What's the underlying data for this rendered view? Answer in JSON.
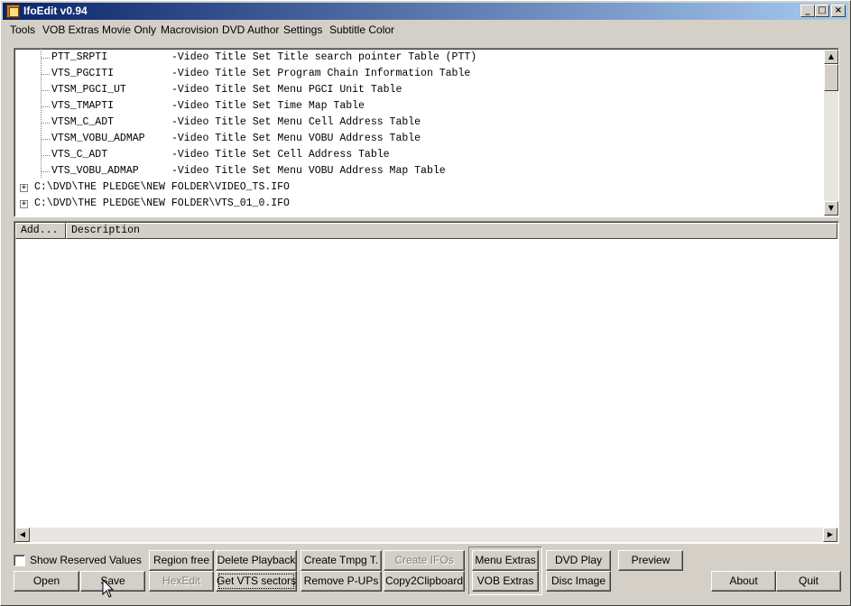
{
  "window": {
    "title": "IfoEdit v0.94",
    "controls": {
      "minimize": "_",
      "maximize": "□",
      "close": "×"
    }
  },
  "menu": [
    "Tools",
    "VOB Extras",
    "Movie Only",
    "Macrovision",
    "DVD Author",
    "Settings",
    "Subtitle Color"
  ],
  "tree": {
    "children": [
      {
        "name": "PTT_SRPTI",
        "desc": "-Video Title Set Title search pointer Table (PTT)"
      },
      {
        "name": "VTS_PGCITI",
        "desc": "-Video Title Set Program Chain Information Table"
      },
      {
        "name": "VTSM_PGCI_UT",
        "desc": "-Video Title Set Menu PGCI Unit Table"
      },
      {
        "name": "VTS_TMAPTI",
        "desc": "-Video Title Set Time Map Table"
      },
      {
        "name": "VTSM_C_ADT",
        "desc": "-Video Title Set Menu Cell Address Table"
      },
      {
        "name": "VTSM_VOBU_ADMAP",
        "desc": "-Video Title Set Menu VOBU Address Table"
      },
      {
        "name": "VTS_C_ADT",
        "desc": "-Video Title Set Cell Address Table"
      },
      {
        "name": "VTS_VOBU_ADMAP",
        "desc": "-Video Title Set Menu VOBU Address Map Table"
      }
    ],
    "roots": [
      {
        "path": "C:\\DVD\\THE PLEDGE\\NEW FOLDER\\VIDEO_TS.IFO",
        "expander": "+"
      },
      {
        "path": "C:\\DVD\\THE PLEDGE\\NEW FOLDER\\VTS_01_0.IFO",
        "expander": "+"
      }
    ]
  },
  "list": {
    "columns": [
      "Add...",
      "Description"
    ]
  },
  "scroll": {
    "up": "▲",
    "down": "▼",
    "left": "◀",
    "right": "▶"
  },
  "checkbox": {
    "label": "Show Reserved Values",
    "checked": false
  },
  "buttons": {
    "open": "Open",
    "save": "Save",
    "region_free": "Region free",
    "hexedit": "HexEdit",
    "delete_playback": "Delete Playback",
    "get_vts_sectors": "Get VTS sectors",
    "create_tmpg": "Create Tmpg T.",
    "remove_pups": "Remove P-UPs",
    "create_ifos": "Create IFOs",
    "copy2clipboard": "Copy2Clipboard",
    "menu_extras": "Menu Extras",
    "vob_extras": "VOB Extras",
    "dvd_play": "DVD Play",
    "disc_image": "Disc Image",
    "preview": "Preview",
    "about": "About",
    "quit": "Quit"
  }
}
